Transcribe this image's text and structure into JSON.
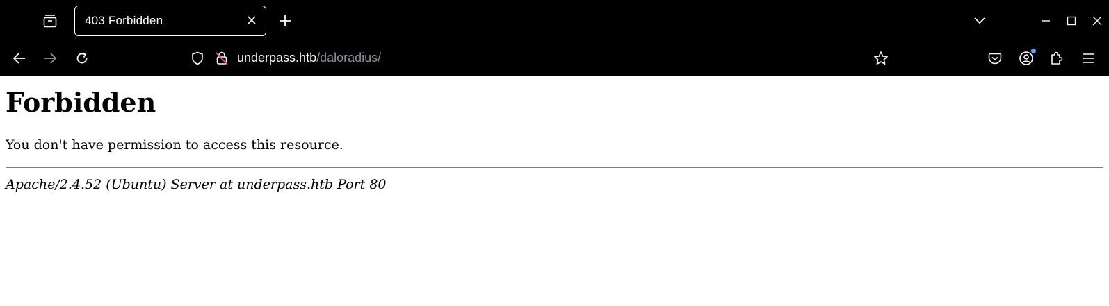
{
  "tab": {
    "title": "403 Forbidden"
  },
  "address_bar": {
    "host": "underpass.htb",
    "path": "/daloradius/"
  },
  "icons": {
    "tab_manager": "tab-manager-icon",
    "close_tab": "close-icon",
    "new_tab": "plus-icon",
    "list_all_tabs": "chevron-down-icon",
    "minimize": "minimize-icon",
    "maximize": "maximize-icon",
    "close_window": "close-icon",
    "back": "arrow-left-icon",
    "forward": "arrow-right-icon",
    "reload": "reload-icon",
    "tracking_protection": "shield-icon",
    "insecure_connection": "lock-strike-icon",
    "bookmark": "star-icon",
    "pocket": "pocket-icon",
    "account": "account-icon",
    "extensions": "puzzle-icon",
    "menu": "hamburger-menu-icon"
  },
  "colors": {
    "chrome_background": "#000000",
    "chrome_text": "#fbfbfe",
    "url_path": "#8f8f9d",
    "notification_dot": "#54a9ff",
    "page_background": "#ffffff",
    "rule": "#808080"
  },
  "page": {
    "heading": "Forbidden",
    "message": "You don't have permission to access this resource.",
    "server_signature": "Apache/2.4.52 (Ubuntu) Server at underpass.htb Port 80"
  }
}
